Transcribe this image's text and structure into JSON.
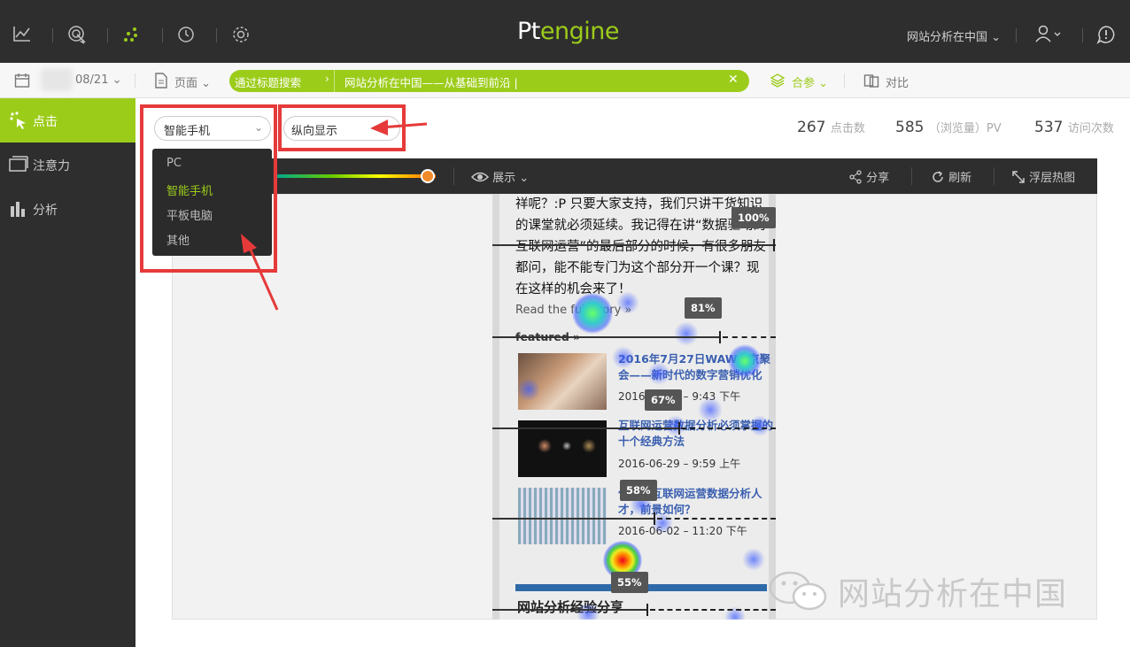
{
  "logo": {
    "pt": "Pt",
    "engine": "engine"
  },
  "topnav": {
    "site_selector": "网站分析在中国",
    "icons": [
      "trend-chart-icon",
      "target-click-icon",
      "heatmap-dots-icon",
      "clock-icon",
      "settings-gear-icon"
    ]
  },
  "subbar": {
    "date": "08/21",
    "page_selector": "页面",
    "search_mode": "通过标题搜索",
    "search_value": "网站分析在中国——从基础到前沿 |",
    "segment": "合参",
    "compare": "对比"
  },
  "sidebar": {
    "items": [
      {
        "label": "点击",
        "icon": "click-icon",
        "active": true
      },
      {
        "label": "注意力",
        "icon": "monitor-icon",
        "active": false
      },
      {
        "label": "分析",
        "icon": "bar-chart-icon",
        "active": false
      }
    ]
  },
  "filters": {
    "device": "智能手机",
    "orientation": "纵向显示",
    "device_options": [
      "PC",
      "智能手机",
      "平板电脑",
      "其他"
    ]
  },
  "stats": [
    {
      "value": "267",
      "unit": "点击数"
    },
    {
      "value": "585",
      "unit": "（浏览量）PV"
    },
    {
      "value": "537",
      "unit": "访问次数"
    }
  ],
  "toolbar": {
    "display": "展示",
    "share": "分享",
    "refresh": "刷新",
    "float_heatmap": "浮层热图",
    "slider_level": 0.95
  },
  "page": {
    "paragraph": "祥呢？:P 只要大家支持，我们只讲干货知识的课堂就必须延续。我记得在讲“数据驱动的互联网运营”的最后部分的时候，有很多朋友都问，能不能专门为这个部分开一个课？现在这样的机会来了！",
    "read_more": "Read the full story »",
    "featured": "featured »",
    "articles": [
      {
        "title": "2016年7月27日WAW北京聚会——新时代的数字营销优化",
        "date": "2016-07-03 – 9:43 下午"
      },
      {
        "title": "互联网运营数据分析必须掌握的十个经典方法",
        "date": "2016-06-29 – 9:59 上午"
      },
      {
        "title": "什么是互联网运营数据分析人才，前景如何？",
        "date": "2016-06-02 – 11:20 下午"
      }
    ],
    "section_title": "网站分析经验分享"
  },
  "scroll_markers": [
    "100%",
    "81%",
    "67%",
    "58%",
    "55%"
  ],
  "watermark": "网站分析在中国",
  "colors": {
    "accent": "#9ccc1a",
    "dark": "#2e2e2e",
    "highlight": "#e63a3a"
  }
}
